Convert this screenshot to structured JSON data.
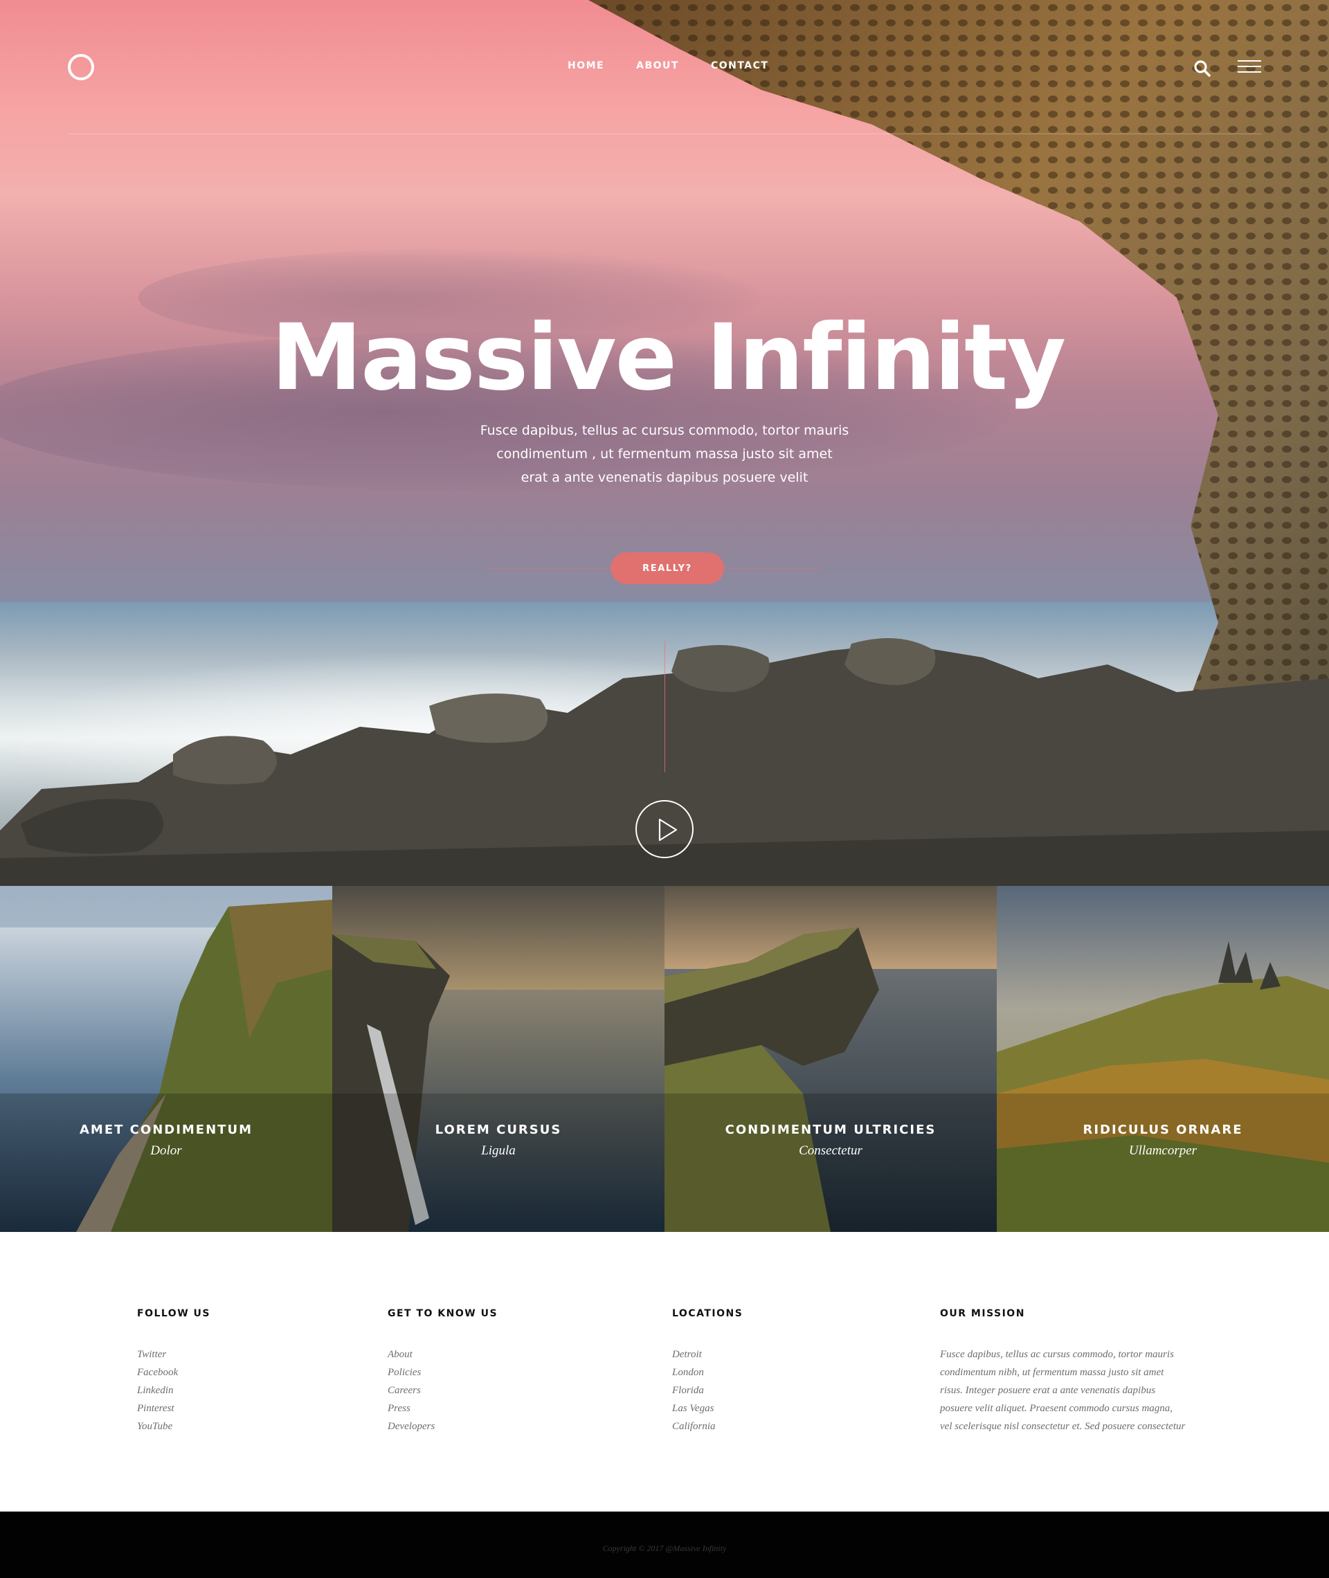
{
  "header": {
    "nav": [
      "HOME",
      "ABOUT",
      "CONTACT"
    ]
  },
  "hero": {
    "title": "Massive Infinity",
    "subtitle_lines": [
      "Fusce dapibus, tellus ac cursus commodo, tortor mauris",
      "condimentum , ut fermentum massa justo sit amet",
      "erat a ante venenatis dapibus posuere velit"
    ],
    "cta_label": "REALLY?"
  },
  "tiles": [
    {
      "title": "AMET CONDIMENTUM",
      "subtitle": "Dolor"
    },
    {
      "title": "LOREM CURSUS",
      "subtitle": "Ligula"
    },
    {
      "title": "CONDIMENTUM ULTRICIES",
      "subtitle": "Consectetur"
    },
    {
      "title": "RIDICULUS ORNARE",
      "subtitle": "Ullamcorper"
    }
  ],
  "footer": {
    "follow": {
      "heading": "FOLLOW US",
      "links": [
        "Twitter",
        "Facebook",
        "Linkedin",
        "Pinterest",
        "YouTube"
      ]
    },
    "know": {
      "heading": "GET TO KNOW US",
      "links": [
        "About",
        "Policies",
        "Careers",
        "Press",
        "Developers"
      ]
    },
    "locations": {
      "heading": "LOCATIONS",
      "links": [
        "Detroit",
        "London",
        "Florida",
        "Las Vegas",
        "California"
      ]
    },
    "mission": {
      "heading": "OUR MISSION",
      "lines": [
        "Fusce dapibus, tellus ac cursus commodo, tortor mauris",
        "condimentum nibh, ut fermentum massa justo sit amet",
        "risus. Integer posuere erat a ante venenatis dapibus",
        "posuere velit aliquet. Praesent commodo cursus magna,",
        "vel scelerisque nisl consectetur et. Sed posuere consectetur"
      ]
    },
    "copyright": "Copyright © 2017 @Massive Infinity"
  },
  "colors": {
    "accent": "#e0716f",
    "footer_bar": "#020202"
  },
  "icons": [
    "logo-ring-icon",
    "search-icon",
    "hamburger-menu-icon",
    "play-icon"
  ]
}
